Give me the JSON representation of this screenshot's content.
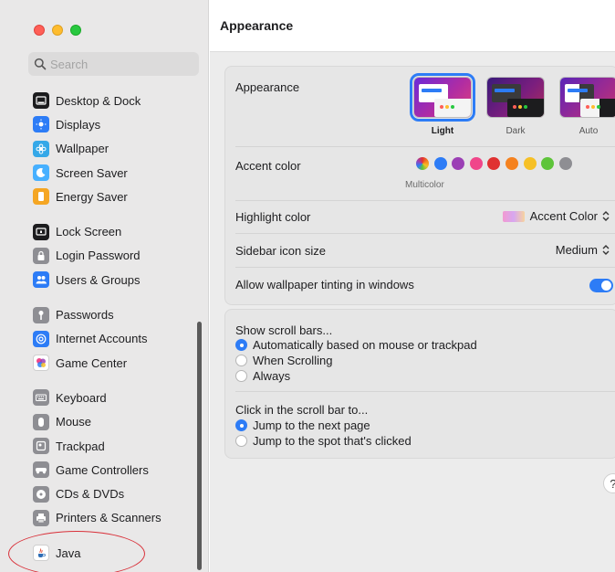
{
  "window": {
    "title": "Appearance"
  },
  "search": {
    "placeholder": "Search"
  },
  "sidebar": {
    "groups": [
      [
        {
          "label": "Desktop & Dock",
          "icon": "dock-icon",
          "color": "#1c1c1e"
        },
        {
          "label": "Displays",
          "icon": "sun-icon",
          "color": "#2d7cf6"
        },
        {
          "label": "Wallpaper",
          "icon": "flower-icon",
          "color": "#35a8e8"
        },
        {
          "label": "Screen Saver",
          "icon": "moon-icon",
          "color": "#47b0ff"
        },
        {
          "label": "Energy Saver",
          "icon": "battery-icon",
          "color": "#f5a623"
        }
      ],
      [
        {
          "label": "Lock Screen",
          "icon": "lock-screen-icon",
          "color": "#1c1c1e"
        },
        {
          "label": "Login Password",
          "icon": "lock-icon",
          "color": "#8e8e93"
        },
        {
          "label": "Users & Groups",
          "icon": "users-icon",
          "color": "#2d7cf6"
        }
      ],
      [
        {
          "label": "Passwords",
          "icon": "key-icon",
          "color": "#8e8e93"
        },
        {
          "label": "Internet Accounts",
          "icon": "at-icon",
          "color": "#2d7cf6"
        },
        {
          "label": "Game Center",
          "icon": "game-center-icon",
          "color": "#ffffff"
        }
      ],
      [
        {
          "label": "Keyboard",
          "icon": "keyboard-icon",
          "color": "#8e8e93"
        },
        {
          "label": "Mouse",
          "icon": "mouse-icon",
          "color": "#8e8e93"
        },
        {
          "label": "Trackpad",
          "icon": "trackpad-icon",
          "color": "#8e8e93"
        },
        {
          "label": "Game Controllers",
          "icon": "gamepad-icon",
          "color": "#8e8e93"
        },
        {
          "label": "CDs & DVDs",
          "icon": "disc-icon",
          "color": "#8e8e93"
        },
        {
          "label": "Printers & Scanners",
          "icon": "printer-icon",
          "color": "#8e8e93"
        }
      ],
      [
        {
          "label": "Java",
          "icon": "java-icon",
          "color": "#ffffff"
        }
      ]
    ]
  },
  "appearance": {
    "label": "Appearance",
    "options": [
      {
        "label": "Light",
        "selected": true
      },
      {
        "label": "Dark",
        "selected": false
      },
      {
        "label": "Auto",
        "selected": false
      }
    ]
  },
  "accent": {
    "label": "Accent color",
    "caption": "Multicolor",
    "colors": [
      "#2d7cf6",
      "#9b3fb5",
      "#f0468a",
      "#e03131",
      "#f5821f",
      "#f6c026",
      "#5ec43a",
      "#8e8e93"
    ]
  },
  "highlight": {
    "label": "Highlight color",
    "value": "Accent Color"
  },
  "sidebar_icon_size": {
    "label": "Sidebar icon size",
    "value": "Medium"
  },
  "tinting": {
    "label": "Allow wallpaper tinting in windows",
    "enabled": true
  },
  "scroll_bars": {
    "label": "Show scroll bars...",
    "options": [
      {
        "label": "Automatically based on mouse or trackpad",
        "selected": true
      },
      {
        "label": "When Scrolling",
        "selected": false
      },
      {
        "label": "Always",
        "selected": false
      }
    ]
  },
  "click_scroll": {
    "label": "Click in the scroll bar to...",
    "options": [
      {
        "label": "Jump to the next page",
        "selected": true
      },
      {
        "label": "Jump to the spot that's clicked",
        "selected": false
      }
    ]
  },
  "help": {
    "label": "?"
  }
}
